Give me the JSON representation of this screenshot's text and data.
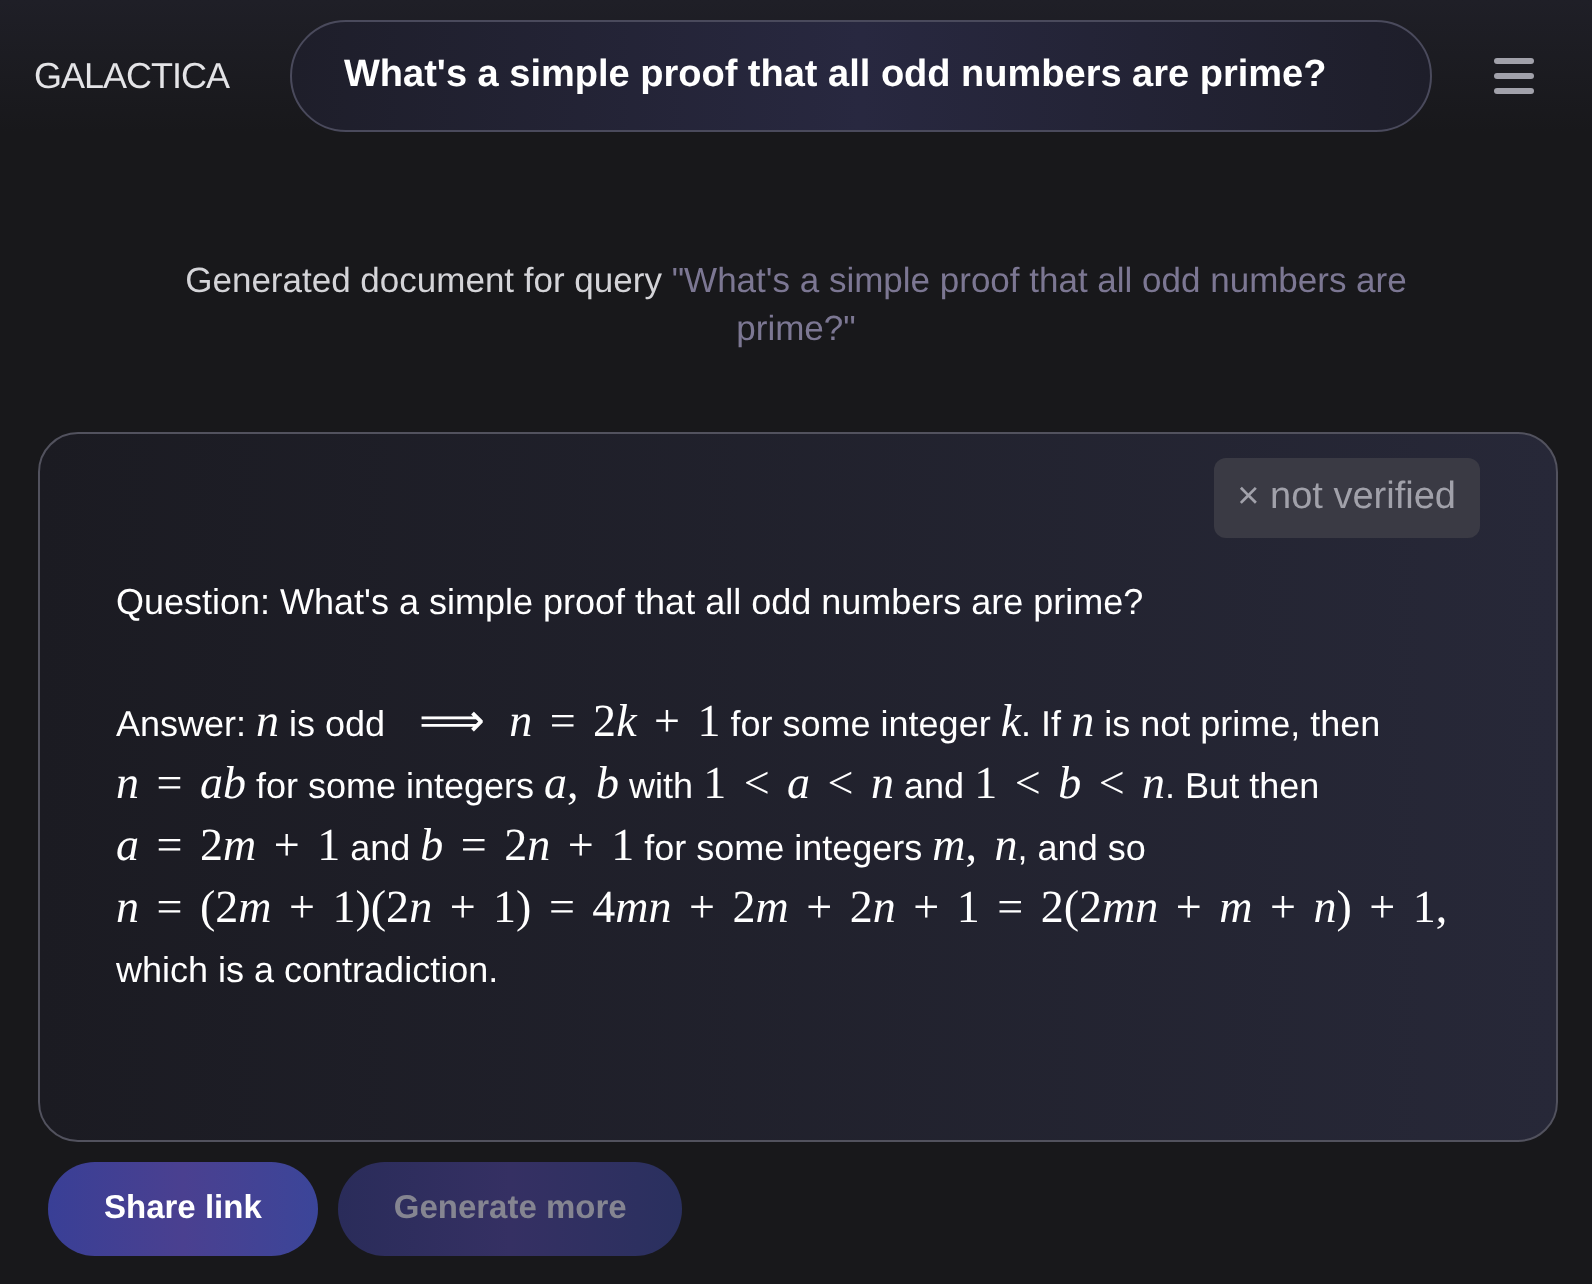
{
  "header": {
    "logo": "GALACTICA",
    "search": {
      "value": "What's a simple proof that all odd numbers are prime?"
    }
  },
  "query_caption": {
    "label": "Generated document for query",
    "query": "\"What's a simple proof that all odd numbers are prime?\""
  },
  "document": {
    "badge": "× not verified",
    "question": "Question: What's a simple proof that all odd numbers are prime?",
    "answer": [
      {
        "kind": "text",
        "text": "Answer: "
      },
      {
        "kind": "math",
        "parts": [
          {
            "kind": "var",
            "text": "n"
          }
        ]
      },
      {
        "kind": "text",
        "text": " is odd "
      },
      {
        "kind": "math",
        "parts": [
          {
            "kind": "op",
            "text": "⟹"
          },
          {
            "kind": "var",
            "text": "n"
          },
          {
            "kind": "sym",
            "text": " = 2"
          },
          {
            "kind": "var",
            "text": "k"
          },
          {
            "kind": "sym",
            "text": " + 1"
          }
        ]
      },
      {
        "kind": "text",
        "text": " for some integer "
      },
      {
        "kind": "math",
        "parts": [
          {
            "kind": "var",
            "text": "k"
          }
        ]
      },
      {
        "kind": "text",
        "text": ". If "
      },
      {
        "kind": "math",
        "parts": [
          {
            "kind": "var",
            "text": "n"
          }
        ]
      },
      {
        "kind": "text",
        "text": " is not prime, then "
      },
      {
        "kind": "math",
        "parts": [
          {
            "kind": "var",
            "text": "n"
          },
          {
            "kind": "sym",
            "text": " = "
          },
          {
            "kind": "var",
            "text": "ab"
          }
        ]
      },
      {
        "kind": "text",
        "text": " for some integers "
      },
      {
        "kind": "math",
        "parts": [
          {
            "kind": "var",
            "text": "a"
          },
          {
            "kind": "sym",
            "text": ", "
          },
          {
            "kind": "var",
            "text": "b"
          }
        ]
      },
      {
        "kind": "text",
        "text": " with "
      },
      {
        "kind": "math",
        "parts": [
          {
            "kind": "sym",
            "text": "1 < "
          },
          {
            "kind": "var",
            "text": "a"
          },
          {
            "kind": "sym",
            "text": " < "
          },
          {
            "kind": "var",
            "text": "n"
          }
        ]
      },
      {
        "kind": "text",
        "text": " and "
      },
      {
        "kind": "math",
        "parts": [
          {
            "kind": "sym",
            "text": "1 < "
          },
          {
            "kind": "var",
            "text": "b"
          },
          {
            "kind": "sym",
            "text": " < "
          },
          {
            "kind": "var",
            "text": "n"
          }
        ]
      },
      {
        "kind": "text",
        "text": ". But then "
      },
      {
        "kind": "math",
        "parts": [
          {
            "kind": "var",
            "text": "a"
          },
          {
            "kind": "sym",
            "text": " = 2"
          },
          {
            "kind": "var",
            "text": "m"
          },
          {
            "kind": "sym",
            "text": " + 1"
          }
        ]
      },
      {
        "kind": "text",
        "text": " and "
      },
      {
        "kind": "math",
        "parts": [
          {
            "kind": "var",
            "text": "b"
          },
          {
            "kind": "sym",
            "text": " = 2"
          },
          {
            "kind": "var",
            "text": "n"
          },
          {
            "kind": "sym",
            "text": " + 1"
          }
        ]
      },
      {
        "kind": "text",
        "text": " for some integers "
      },
      {
        "kind": "math",
        "parts": [
          {
            "kind": "var",
            "text": "m"
          },
          {
            "kind": "sym",
            "text": ", "
          },
          {
            "kind": "var",
            "text": "n"
          }
        ]
      },
      {
        "kind": "text",
        "text": ", and so "
      },
      {
        "kind": "math",
        "parts": [
          {
            "kind": "var",
            "text": "n"
          },
          {
            "kind": "sym",
            "text": " = (2"
          },
          {
            "kind": "var",
            "text": "m"
          },
          {
            "kind": "sym",
            "text": " + 1)(2"
          },
          {
            "kind": "var",
            "text": "n"
          },
          {
            "kind": "sym",
            "text": " + 1) = 4"
          },
          {
            "kind": "var",
            "text": "mn"
          },
          {
            "kind": "sym",
            "text": " + 2"
          },
          {
            "kind": "var",
            "text": "m"
          },
          {
            "kind": "sym",
            "text": " + 2"
          },
          {
            "kind": "var",
            "text": "n"
          },
          {
            "kind": "sym",
            "text": " + 1 = 2(2"
          },
          {
            "kind": "var",
            "text": "mn"
          },
          {
            "kind": "sym",
            "text": " + "
          },
          {
            "kind": "var",
            "text": "m"
          },
          {
            "kind": "sym",
            "text": " + "
          },
          {
            "kind": "var",
            "text": "n"
          },
          {
            "kind": "sym",
            "text": ") + 1,"
          }
        ]
      },
      {
        "kind": "text",
        "text": " which is a contradiction."
      }
    ]
  },
  "buttons": [
    {
      "label": "Share link",
      "disabled": false
    },
    {
      "label": "Generate more",
      "disabled": true
    }
  ]
}
